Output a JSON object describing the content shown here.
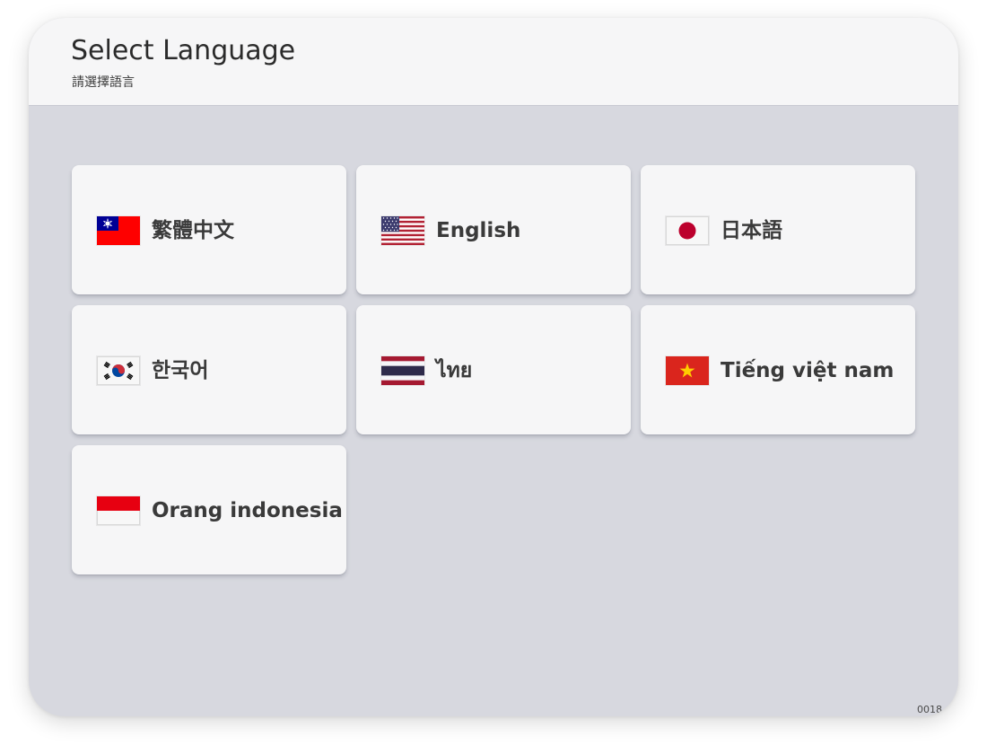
{
  "header": {
    "title": "Select Language",
    "subtitle": "請選擇語言"
  },
  "languages": [
    {
      "label": "繁體中文",
      "flag": "taiwan-flag-icon"
    },
    {
      "label": "English",
      "flag": "usa-flag-icon"
    },
    {
      "label": "日本語",
      "flag": "japan-flag-icon"
    },
    {
      "label": "한국어",
      "flag": "korea-flag-icon"
    },
    {
      "label": "ไทย",
      "flag": "thailand-flag-icon"
    },
    {
      "label": "Tiếng việt nam",
      "flag": "vietnam-flag-icon"
    },
    {
      "label": "Orang indonesia",
      "flag": "indonesia-flag-icon"
    }
  ],
  "footer": {
    "version": "0018"
  },
  "colors": {
    "background": "#d7d8df",
    "header_background": "#f6f6f7",
    "card_background": "#f6f6f7",
    "text": "#3a3a3a"
  }
}
